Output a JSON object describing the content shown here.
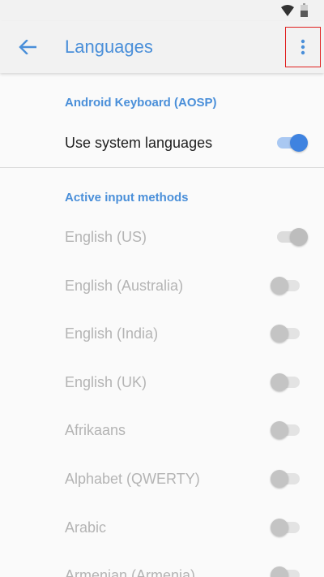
{
  "status_bar": {
    "icons": [
      "wifi-icon",
      "battery-icon"
    ]
  },
  "app_bar": {
    "title": "Languages",
    "back_icon": "arrow-left-icon",
    "overflow_icon": "more-vert-icon",
    "accent_color": "#4a8fd9"
  },
  "sections": {
    "keyboard_header": "Android Keyboard (AOSP)",
    "use_system_languages": {
      "label": "Use system languages",
      "checked": true
    },
    "active_methods_header": "Active input methods"
  },
  "input_methods": [
    {
      "label": "English (US)",
      "checked": true
    },
    {
      "label": "English (Australia)",
      "checked": false
    },
    {
      "label": "English (India)",
      "checked": false
    },
    {
      "label": "English (UK)",
      "checked": false
    },
    {
      "label": "Afrikaans",
      "checked": false
    },
    {
      "label": "Alphabet (QWERTY)",
      "checked": false
    },
    {
      "label": "Arabic",
      "checked": false
    },
    {
      "label": "Armenian (Armenia)",
      "checked": false
    }
  ]
}
